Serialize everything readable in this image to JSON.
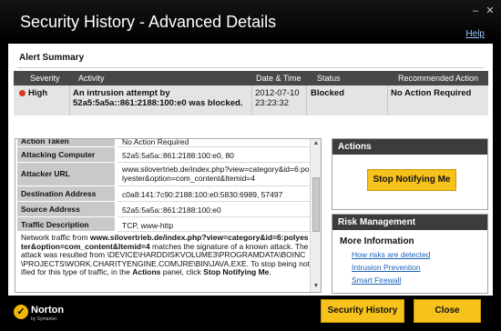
{
  "window": {
    "title": "Security History - Advanced Details",
    "help_label": "Help"
  },
  "alert_summary": {
    "title": "Alert Summary",
    "headers": [
      "Severity",
      "Activity",
      "Date & Time",
      "Status",
      "Recommended Action"
    ],
    "row": {
      "severity": "High",
      "activity": "An intrusion attempt by 52a5:5a5a::861:2188:100:e0 was blocked.",
      "date": "2012-07-10",
      "time": "23:23:32",
      "status": "Blocked",
      "recommended_action": "No Action Required"
    }
  },
  "details": {
    "rows": [
      {
        "key": "Action Taken",
        "value": "No Action Required"
      },
      {
        "key": "Attacking Computer",
        "value": "52a5:5a5a::861:2188:100:e0, 80"
      },
      {
        "key": "Attacker URL",
        "value": "www.silovertrieb.de/index.php?view=category&id=6:polyester&option=com_content&Itemid=4"
      },
      {
        "key": "Destination Address",
        "value": "c0a8:141:7c90:2188:100:e0:5830:6989, 57497"
      },
      {
        "key": "Source Address",
        "value": "52a5:5a5a::861:2188:100:e0"
      },
      {
        "key": "Traffic Description",
        "value": "TCP, www-http"
      }
    ],
    "description": {
      "p1": "Network traffic from ",
      "url": "www.silovertrieb.de/index.php?view=category&id=6:polyester&option=com_content&Itemid=4",
      "p2": " matches the signature of a known attack. The attack was resulted from \\DEVICE\\HARDDISKVOLUME3\\PROGRAMDATA\\BOINC\\PROJECTS\\WORK.CHARITYENGINE.COM\\JRE\\BIN\\JAVA.EXE. To stop being notified for this type of traffic, in the ",
      "actions_word": "Actions",
      "p3": " panel, click ",
      "stop_word": "Stop Notifying Me",
      "p4": "."
    }
  },
  "actions_panel": {
    "title": "Actions",
    "stop_button": "Stop Notifying Me"
  },
  "risk_panel": {
    "title": "Risk Management",
    "more_info": "More Information",
    "links": [
      "How risks are detected",
      "Intrusion Prevention",
      "Smart Firewall"
    ]
  },
  "footer": {
    "logo_word": "Norton",
    "logo_sub": "by Symantec",
    "history_button": "Security History",
    "close_button": "Close"
  },
  "colors": {
    "accent_yellow": "#f6c21b",
    "severity_high": "#d63a1c",
    "link_blue": "#1b5fb5"
  }
}
